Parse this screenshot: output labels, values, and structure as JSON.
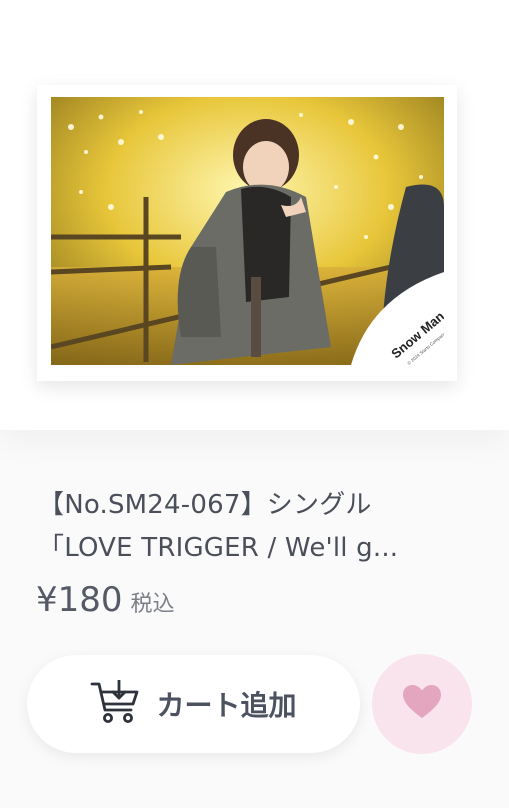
{
  "product": {
    "title_line1": "【No.SM24-067】シングル",
    "title_line2": "「LOVE TRIGGER / We'll g...",
    "price": "¥180",
    "tax_label": "税込",
    "photo": {
      "watermark_brand": "Snow Man",
      "watermark_copyright": "© 2024 Starto Company Inc."
    }
  },
  "actions": {
    "cart_label": "カート追加",
    "cart_icon": "cart-download-icon",
    "favorite_icon": "heart-icon"
  },
  "colors": {
    "text": "#4b4f59",
    "heart": "#e4a5be",
    "favorite_bg": "#f9e3ec"
  }
}
